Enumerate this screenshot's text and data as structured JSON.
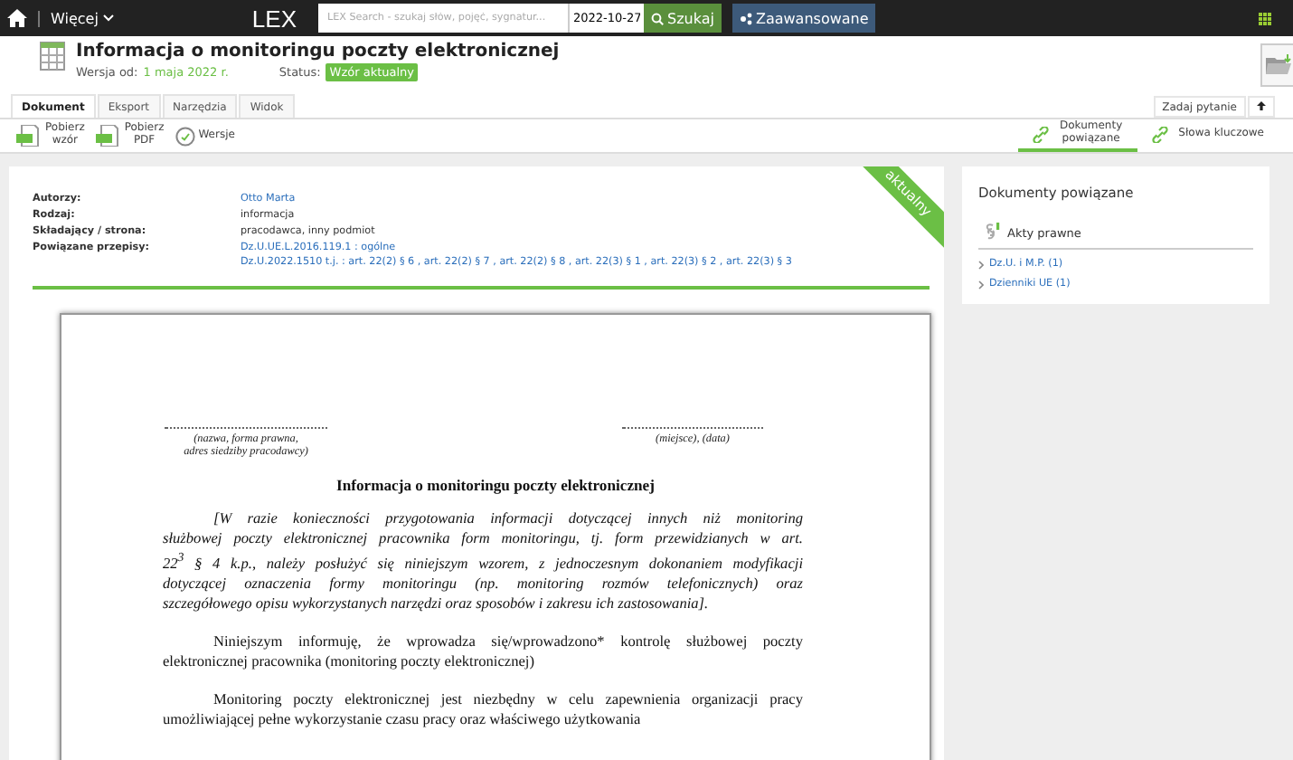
{
  "topbar": {
    "more": "Więcej",
    "logo": "LEX",
    "search": {
      "placeholder": "LEX Search - szukaj słów, pojęć, sygnatur..."
    },
    "date": "2022-10-27",
    "search_button": "Szukaj",
    "advanced_button": "Zaawansowane"
  },
  "header": {
    "title": "Informacja o monitoringu poczty elektronicznej",
    "version_label": "Wersja od:",
    "version": "1 maja 2022 r.",
    "status_label": "Status:",
    "status": "Wzór aktualny",
    "ask": "Zadaj pytanie"
  },
  "tabs": [
    {
      "label": "Dokument",
      "selected": true
    },
    {
      "label": "Eksport",
      "selected": false
    },
    {
      "label": "Narzędzia",
      "selected": false
    },
    {
      "label": "Widok",
      "selected": false
    }
  ],
  "toolbar": [
    {
      "kind": "doc",
      "label": "Pobierz\nwzór"
    },
    {
      "kind": "pdf",
      "label": "Pobierz\nPDF"
    },
    {
      "kind": "versions",
      "label": "Wersje"
    }
  ],
  "side_tabs": [
    {
      "label": "Dokumenty\npowiązane",
      "selected": true
    },
    {
      "label": "Słowa kluczowe",
      "selected": false
    }
  ],
  "ribbon": "aktualny",
  "meta": [
    {
      "label": "Autorzy:",
      "values": [
        {
          "text": "Otto Marta",
          "link": true
        }
      ]
    },
    {
      "label": "Rodzaj:",
      "values": [
        {
          "text": "informacja",
          "link": false
        }
      ]
    },
    {
      "label": "Składający / strona:",
      "values": [
        {
          "text": "pracodawca, inny podmiot",
          "link": false
        }
      ]
    },
    {
      "label": "Powiązane przepisy:",
      "values": [
        {
          "text": "Dz.U.UE.L.2016.119.1 : ogólne",
          "link": true
        },
        {
          "text": "Dz.U.2022.1510 t.j. : art. 22(2) § 6 , art. 22(2) § 7 , art. 22(2) § 8 , art. 22(3) § 1 , art. 22(3) § 2 , art. 22(3) § 3",
          "link": true
        }
      ]
    }
  ],
  "document": {
    "sender": "(nazwa, forma prawna,\nadres siedziby pracodawcy)",
    "place": "(miejsce), (data)",
    "heading": "Informacja o monitoringu poczty elektronicznej",
    "paragraphs": [
      {
        "kind": "italic",
        "lines": [
          "[W razie konieczności przygotowania informacji dotyczącej innych niż monitoring",
          "służbowej poczty elektronicznej pracownika form monitoringu, tj. form przewidzianych w art.",
          "22$^{3}$ § 4 k.p., należy posłużyć się niniejszym wzorem, z jednoczesnym dokonaniem modyfikacji",
          "dotyczącej oznaczenia formy monitoringu (np. monitoring rozmów telefonicznych) oraz",
          "szczegółowego opisu wykorzystanych narzędzi oraz sposobów i zakresu ich zastosowania]."
        ]
      },
      {
        "kind": "normal",
        "lines": [
          "Niniejszym informuję, że wprowadza się/wprowadzono* kontrolę służbowej poczty",
          "elektronicznej pracownika (monitoring poczty elektronicznej)"
        ]
      },
      {
        "kind": "normal",
        "lines": [
          "Monitoring poczty elektronicznej jest niezbędny w celu zapewnienia organizacji pracy",
          "umożliwiającej pełne wykorzystanie czasu pracy oraz właściwego użytkowania"
        ]
      }
    ]
  },
  "related": {
    "title": "Dokumenty powiązane",
    "section": "Akty prawne",
    "items": [
      "Dz.U. i M.P. (1)",
      "Dzienniki UE (1)"
    ]
  }
}
